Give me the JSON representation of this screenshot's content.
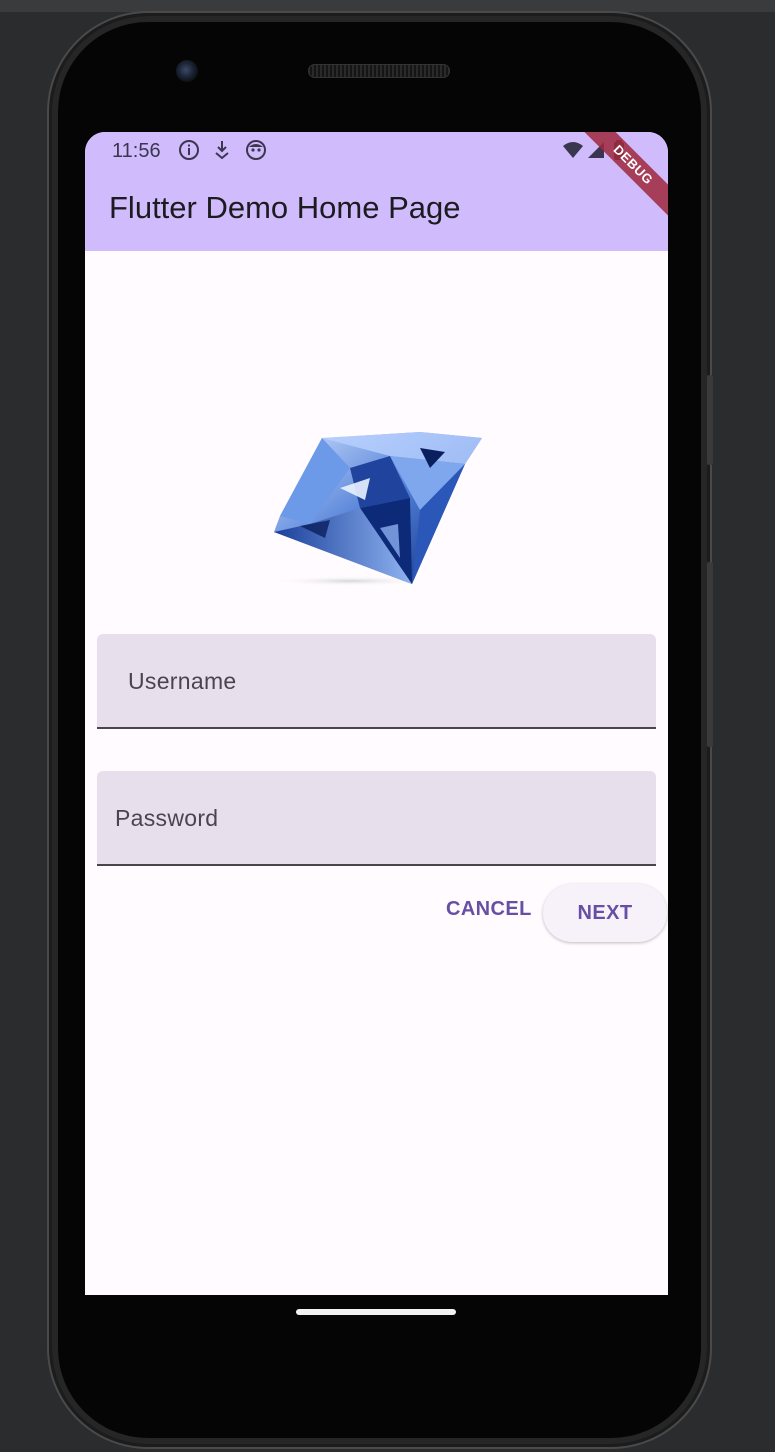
{
  "status_bar": {
    "time": "11:56"
  },
  "app_bar": {
    "title": "Flutter Demo Home Page",
    "debug_banner": "DEBUG"
  },
  "form": {
    "username_label": "Username",
    "password_label": "Password"
  },
  "buttons": {
    "cancel": "CANCEL",
    "next": "NEXT"
  },
  "colors": {
    "app_bar": "#d0bcfc",
    "primary": "#6750a4",
    "field_fill": "#e7e0ec",
    "background": "#fffbfe"
  }
}
